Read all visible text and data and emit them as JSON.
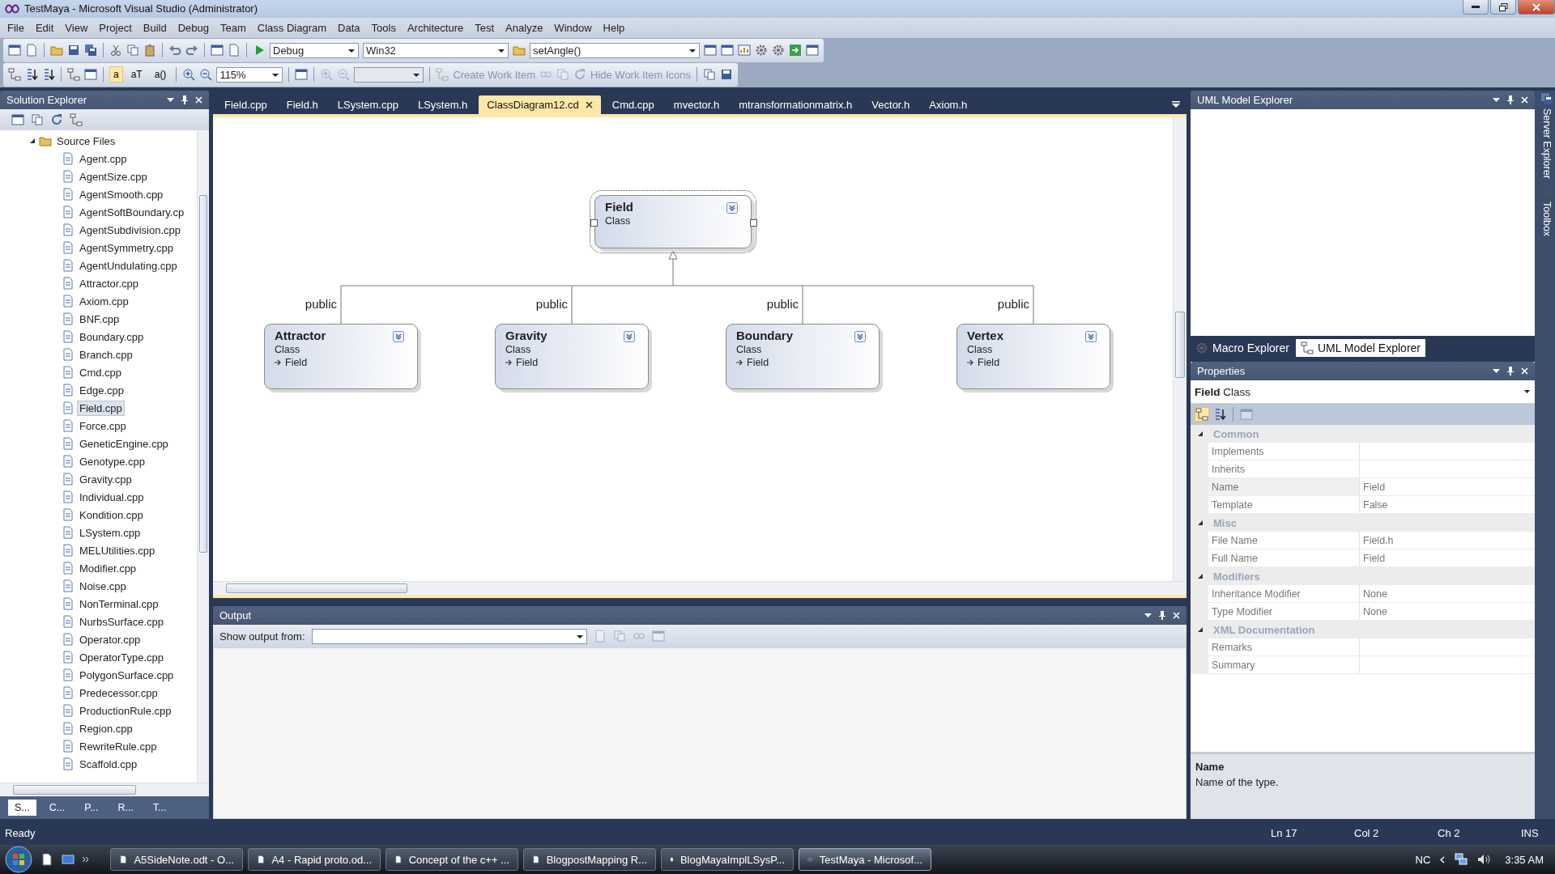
{
  "window": {
    "title": "TestMaya - Microsoft Visual Studio (Administrator)"
  },
  "menu": [
    "File",
    "Edit",
    "View",
    "Project",
    "Build",
    "Debug",
    "Team",
    "Class Diagram",
    "Data",
    "Tools",
    "Architecture",
    "Test",
    "Analyze",
    "Window",
    "Help"
  ],
  "toolbar": {
    "configuration": "Debug",
    "platform": "Win32",
    "find": "setAngle()",
    "member_format_buttons": [
      {
        "label": "a",
        "selected": true
      },
      {
        "label": "aT",
        "selected": false
      },
      {
        "label": "a()",
        "selected": false
      }
    ],
    "zoom": "115%",
    "work_item": {
      "label": "Create Work Item",
      "disabled": true
    },
    "hide_work_items": {
      "label": "Hide Work Item Icons",
      "disabled": true
    }
  },
  "solution_explorer": {
    "title": "Solution Explorer",
    "folder": {
      "label": "Source Files",
      "expanded": true,
      "children": [
        {
          "label": "Agent.cpp",
          "selected": false
        },
        {
          "label": "AgentSize.cpp",
          "selected": false
        },
        {
          "label": "AgentSmooth.cpp",
          "selected": false
        },
        {
          "label": "AgentSoftBoundary.cp",
          "selected": false
        },
        {
          "label": "AgentSubdivision.cpp",
          "selected": false
        },
        {
          "label": "AgentSymmetry.cpp",
          "selected": false
        },
        {
          "label": "AgentUndulating.cpp",
          "selected": false
        },
        {
          "label": "Attractor.cpp",
          "selected": false
        },
        {
          "label": "Axiom.cpp",
          "selected": false
        },
        {
          "label": "BNF.cpp",
          "selected": false
        },
        {
          "label": "Boundary.cpp",
          "selected": false
        },
        {
          "label": "Branch.cpp",
          "selected": false
        },
        {
          "label": "Cmd.cpp",
          "selected": false
        },
        {
          "label": "Edge.cpp",
          "selected": false
        },
        {
          "label": "Field.cpp",
          "selected": true
        },
        {
          "label": "Force.cpp",
          "selected": false
        },
        {
          "label": "GeneticEngine.cpp",
          "selected": false
        },
        {
          "label": "Genotype.cpp",
          "selected": false
        },
        {
          "label": "Gravity.cpp",
          "selected": false
        },
        {
          "label": "Individual.cpp",
          "selected": false
        },
        {
          "label": "Kondition.cpp",
          "selected": false
        },
        {
          "label": "LSystem.cpp",
          "selected": false
        },
        {
          "label": "MELUtilities.cpp",
          "selected": false
        },
        {
          "label": "Modifier.cpp",
          "selected": false
        },
        {
          "label": "Noise.cpp",
          "selected": false
        },
        {
          "label": "NonTerminal.cpp",
          "selected": false
        },
        {
          "label": "NurbsSurface.cpp",
          "selected": false
        },
        {
          "label": "Operator.cpp",
          "selected": false
        },
        {
          "label": "OperatorType.cpp",
          "selected": false
        },
        {
          "label": "PolygonSurface.cpp",
          "selected": false
        },
        {
          "label": "Predecessor.cpp",
          "selected": false
        },
        {
          "label": "ProductionRule.cpp",
          "selected": false
        },
        {
          "label": "Region.cpp",
          "selected": false
        },
        {
          "label": "RewriteRule.cpp",
          "selected": false
        },
        {
          "label": "Scaffold.cpp",
          "selected": false
        }
      ]
    },
    "bottom_tabs": [
      {
        "label": "S...",
        "selected": true
      },
      {
        "label": "C...",
        "selected": false
      },
      {
        "label": "P...",
        "selected": false
      },
      {
        "label": "R...",
        "selected": false
      },
      {
        "label": "T...",
        "selected": false
      }
    ]
  },
  "document_tabs": [
    {
      "label": "Field.cpp",
      "selected": false
    },
    {
      "label": "Field.h",
      "selected": false
    },
    {
      "label": "LSystem.cpp",
      "selected": false
    },
    {
      "label": "LSystem.h",
      "selected": false
    },
    {
      "label": "ClassDiagram12.cd",
      "selected": true
    },
    {
      "label": "Cmd.cpp",
      "selected": false
    },
    {
      "label": "mvector.h",
      "selected": false
    },
    {
      "label": "mtransformationmatrix.h",
      "selected": false
    },
    {
      "label": "Vector.h",
      "selected": false
    },
    {
      "label": "Axiom.h",
      "selected": false
    }
  ],
  "diagram": {
    "base": {
      "name": "Field",
      "stereotype": "Class",
      "selected": true
    },
    "derived": [
      {
        "name": "Attractor",
        "stereotype": "Class",
        "base": "Field",
        "access": "public"
      },
      {
        "name": "Gravity",
        "stereotype": "Class",
        "base": "Field",
        "access": "public"
      },
      {
        "name": "Boundary",
        "stereotype": "Class",
        "base": "Field",
        "access": "public"
      },
      {
        "name": "Vertex",
        "stereotype": "Class",
        "base": "Field",
        "access": "public"
      }
    ]
  },
  "output": {
    "title": "Output",
    "show_output_from": "Show output from:"
  },
  "uml_model_explorer": {
    "title": "UML Model Explorer",
    "tabs": [
      {
        "label": "Macro Explorer",
        "selected": false
      },
      {
        "label": "UML Model Explorer",
        "selected": true
      }
    ]
  },
  "properties": {
    "title": "Properties",
    "object_name": "Field",
    "object_kind": "Class",
    "categories": [
      {
        "name": "Common",
        "expanded": true,
        "rows": [
          {
            "name": "Implements",
            "selected": false
          },
          {
            "name": "Inherits",
            "selected": false
          },
          {
            "name": "Name",
            "value": "Field",
            "selected": true
          },
          {
            "name": "Template",
            "value": "False",
            "selected": false
          }
        ]
      },
      {
        "name": "Misc",
        "expanded": true,
        "rows": [
          {
            "name": "File Name",
            "value": "Field.h",
            "selected": false
          },
          {
            "name": "Full Name",
            "value": "Field",
            "selected": false
          }
        ]
      },
      {
        "name": "Modifiers",
        "expanded": true,
        "rows": [
          {
            "name": "Inheritance Modifier",
            "value": "None",
            "selected": false
          },
          {
            "name": "Type Modifier",
            "value": "None",
            "selected": false
          }
        ]
      },
      {
        "name": "XML Documentation",
        "expanded": true,
        "rows": [
          {
            "name": "Remarks",
            "selected": false
          },
          {
            "name": "Summary",
            "selected": false
          }
        ]
      }
    ],
    "description": {
      "title": "Name",
      "text": "Name of the type."
    }
  },
  "side_tabs": [
    "Server Explorer",
    "Toolbox"
  ],
  "status_bar": {
    "message": "Ready",
    "line": "Ln 17",
    "column": "Col 2",
    "char": "Ch 2",
    "mode": "INS"
  },
  "taskbar": {
    "buttons": [
      {
        "label": "A5SideNote.odt - O...",
        "selected": false
      },
      {
        "label": "A4 - Rapid proto.od...",
        "selected": false
      },
      {
        "label": "Concept of the c++ ...",
        "selected": false
      },
      {
        "label": "BlogpostMapping R...",
        "selected": false
      },
      {
        "label": "BlogMayaImplLSysP...",
        "selected": false
      },
      {
        "label": "TestMaya - Microsof...",
        "selected": true
      }
    ],
    "language": "NC",
    "clock": "3:35 AM"
  }
}
